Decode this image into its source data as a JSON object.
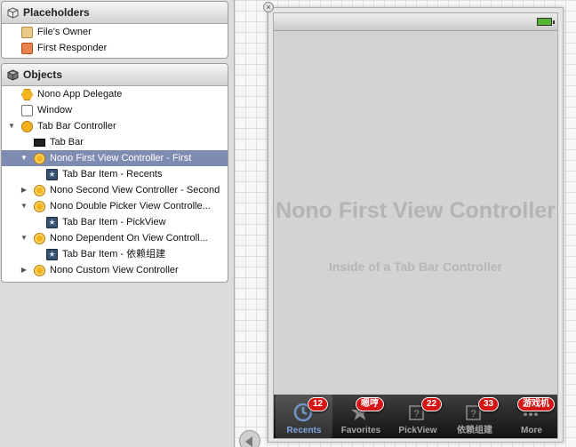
{
  "outline": {
    "placeholders": {
      "title": "Placeholders",
      "items": [
        {
          "label": "File's Owner",
          "icon": "cube-icon"
        },
        {
          "label": "First Responder",
          "icon": "cube-red-icon"
        }
      ]
    },
    "objects": {
      "title": "Objects",
      "items": [
        {
          "label": "Nono App Delegate"
        },
        {
          "label": "Window"
        },
        {
          "label": "Tab Bar Controller"
        },
        {
          "label": "Tab Bar"
        },
        {
          "label": "Nono First View Controller - First"
        },
        {
          "label": "Tab Bar Item - Recents"
        },
        {
          "label": "Nono Second View Controller - Second"
        },
        {
          "label": "Nono Double Picker View Controlle..."
        },
        {
          "label": "Tab Bar Item - PickView"
        },
        {
          "label": "Nono Dependent On View Controll..."
        },
        {
          "label": "Tab Bar Item - 依赖组建"
        },
        {
          "label": "Nono Custom View Controller"
        }
      ]
    }
  },
  "canvas": {
    "title": "Nono First View Controller",
    "subtitle": "Inside of a Tab Bar Controller",
    "tabs": [
      {
        "label": "Recents",
        "badge": "12",
        "icon": "clock-icon",
        "active": true
      },
      {
        "label": "Favorites",
        "badge": "嗯哼",
        "icon": "star-icon",
        "active": false
      },
      {
        "label": "PickView",
        "badge": "22",
        "icon": "question-icon",
        "active": false
      },
      {
        "label": "依赖组建",
        "badge": "33",
        "icon": "question-icon",
        "active": false
      },
      {
        "label": "More",
        "badge": "游戏机",
        "icon": "more-icon",
        "active": false
      }
    ]
  },
  "colors": {
    "selection": "#7f8cb2",
    "badge": "#d41515",
    "active_tab_label": "#7fa7e1"
  }
}
